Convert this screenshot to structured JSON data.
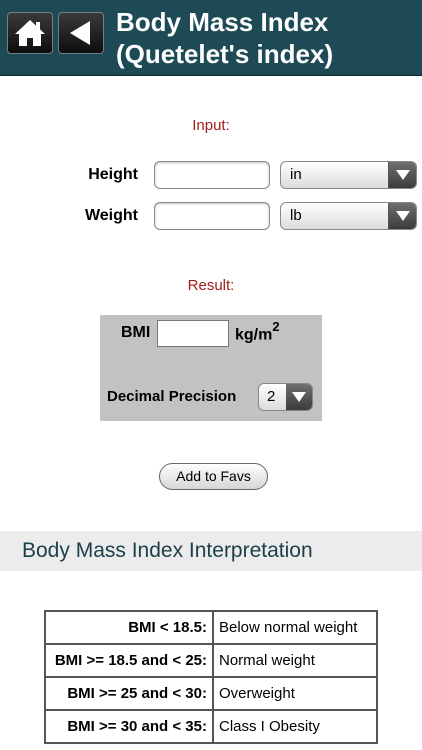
{
  "header": {
    "title_line1": "Body Mass Index",
    "title_line2": "(Quetelet's index)",
    "home_icon": "home-icon",
    "back_icon": "back-arrow-icon"
  },
  "input": {
    "section_label": "Input:",
    "height": {
      "label": "Height",
      "value": "",
      "unit": "in"
    },
    "weight": {
      "label": "Weight",
      "value": "",
      "unit": "lb"
    }
  },
  "result": {
    "section_label": "Result:",
    "bmi_label": "BMI",
    "bmi_value": "",
    "bmi_unit": "kg/m",
    "bmi_unit_sup": "2",
    "precision_label": "Decimal Precision",
    "precision_value": "2"
  },
  "add_to_favs": "Add to Favs",
  "interpretation": {
    "title": "Body Mass Index Interpretation",
    "rows": [
      {
        "range": "BMI < 18.5:",
        "meaning": "Below normal weight"
      },
      {
        "range": "BMI >= 18.5 and < 25:",
        "meaning": "Normal weight"
      },
      {
        "range": "BMI >= 25 and < 30:",
        "meaning": "Overweight"
      },
      {
        "range": "BMI >= 30 and < 35:",
        "meaning": "Class I Obesity"
      }
    ]
  },
  "colors": {
    "header_bg": "#1e4a55",
    "section_label": "#a01d1d",
    "result_bg": "#c2c2c2"
  }
}
